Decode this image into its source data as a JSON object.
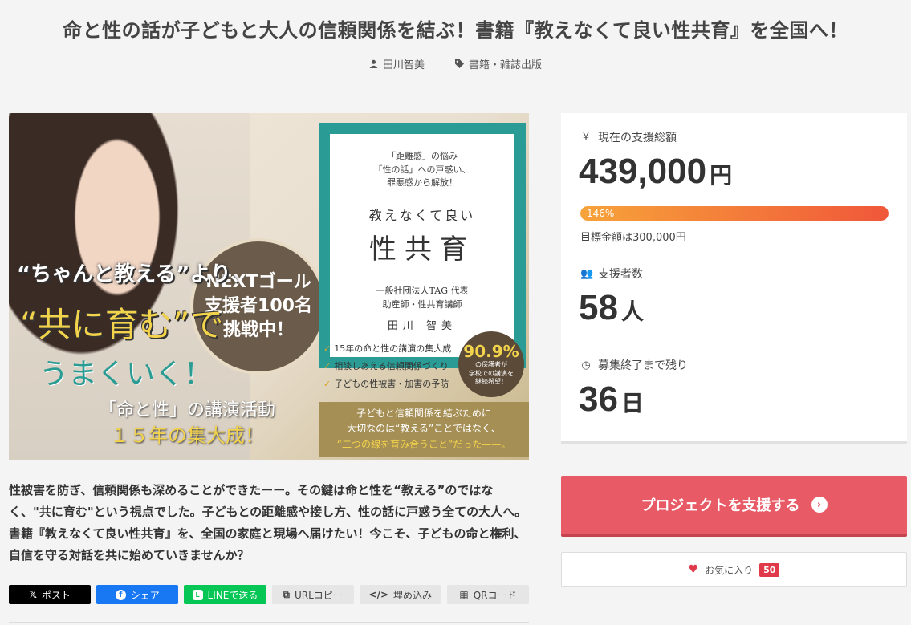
{
  "project": {
    "title": "命と性の話が子どもと大人の信頼関係を結ぶ！書籍『教えなくて良い性共育』を全国へ！",
    "owner": "田川智美",
    "category": "書籍・雑誌出版",
    "description": "性被害を防ぎ、信頼関係も深めることができたーー。その鍵は命と性を“教える”のではなく、\"共に育む\"という視点でした。子どもとの距離感や接し方、性の話に戸惑う全ての大人へ。書籍『教えなくて良い性共育』を、全国の家庭と現場へ届けたい！今こそ、子どもの命と権利、自信を守る対話を共に始めていきませんか？"
  },
  "hero": {
    "goal_line1": "NEXTゴール",
    "goal_line2": "支援者100名",
    "goal_line3": "挑戦中！",
    "book_top": "「距離感」の悩み\n「性の話」への戸惑い、\n罪悪感から解放！",
    "book_sub": "教えなくて良い",
    "book_main": "性共育",
    "book_org": "一般社団法人TAG 代表\n助産師・性共育講師",
    "book_author": "田川 智美",
    "line1": "“ちゃんと教える”より、",
    "line2": "“共に育む”で",
    "line3": "うまくいく！",
    "line4": "「命と性」の講演活動",
    "line5": "１５年の集大成！",
    "checks": [
      "15年の命と性の講演の集大成",
      "相談しあえる信頼関係づくり",
      "子どもの性被害・加害の予防"
    ],
    "badge_num": "90.9%",
    "badge_text": "の保護者が\n学校での講演を\n継続希望！",
    "bottom_1": "子どもと信頼関係を結ぶために",
    "bottom_2": "大切なのは“教える”ことではなく、",
    "bottom_3": "“二つの線を育み合うこと”だった——。"
  },
  "stats": {
    "total_label": "現在の支援総額",
    "total_value": "439,000",
    "total_unit": "円",
    "progress_percent": 146,
    "progress_label": "146%",
    "goal_text": "目標金額は300,000円",
    "supporters_label": "支援者数",
    "supporters_value": "58",
    "supporters_unit": "人",
    "remaining_label": "募集終了まで残り",
    "remaining_value": "36",
    "remaining_unit": "日"
  },
  "actions": {
    "support_label": "プロジェクトを支援する",
    "favorite_label": "お気に入り",
    "favorite_count": "50"
  },
  "share": {
    "x": "ポスト",
    "facebook": "シェア",
    "line": "LINEで送る",
    "url": "URLコピー",
    "embed": "埋め込み",
    "qr": "QRコード"
  },
  "colors": {
    "support_button": "#e85a65",
    "progress_start": "#f7a33a",
    "progress_end": "#f0573a",
    "facebook": "#1877f2",
    "line": "#06c755"
  }
}
